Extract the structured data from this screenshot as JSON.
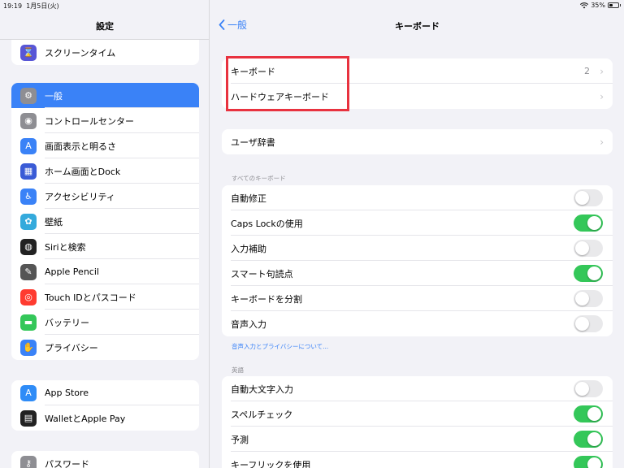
{
  "status": {
    "time": "19:19",
    "date": "1月5日(火)",
    "battery": "35%",
    "battery_level": 0.35
  },
  "sidebar": {
    "title": "設定",
    "groups": [
      [
        {
          "label": "スクリーンタイム",
          "icon": "hourglass-icon",
          "color": "#5856d6"
        }
      ],
      [
        {
          "label": "一般",
          "icon": "gear-icon",
          "color": "#8e8e93",
          "active": true
        },
        {
          "label": "コントロールセンター",
          "icon": "switches-icon",
          "color": "#8e8e93"
        },
        {
          "label": "画面表示と明るさ",
          "icon": "text-size-icon",
          "color": "#3a82f7"
        },
        {
          "label": "ホーム画面とDock",
          "icon": "grid-icon",
          "color": "#3a5bd6"
        },
        {
          "label": "アクセシビリティ",
          "icon": "accessibility-icon",
          "color": "#3a82f7"
        },
        {
          "label": "壁紙",
          "icon": "flower-icon",
          "color": "#34aadc"
        },
        {
          "label": "Siriと検索",
          "icon": "siri-icon",
          "color": "#222222"
        },
        {
          "label": "Apple Pencil",
          "icon": "pencil-icon",
          "color": "#555555"
        },
        {
          "label": "Touch IDとパスコード",
          "icon": "fingerprint-icon",
          "color": "#ff3b30"
        },
        {
          "label": "バッテリー",
          "icon": "battery-icon",
          "color": "#34c759"
        },
        {
          "label": "プライバシー",
          "icon": "hand-icon",
          "color": "#3a82f7"
        }
      ],
      [
        {
          "label": "App Store",
          "icon": "appstore-icon",
          "color": "#2f8cf7"
        },
        {
          "label": "WalletとApple Pay",
          "icon": "wallet-icon",
          "color": "#222222"
        }
      ],
      [
        {
          "label": "パスワード",
          "icon": "key-icon",
          "color": "#8e8e93"
        }
      ]
    ]
  },
  "main": {
    "back_label": "一般",
    "title": "キーボード",
    "group1": [
      {
        "label": "キーボード",
        "value": "2"
      },
      {
        "label": "ハードウェアキーボード",
        "value": ""
      }
    ],
    "group2": [
      {
        "label": "ユーザ辞書",
        "value": ""
      }
    ],
    "section_all": "すべてのキーボード",
    "all_keyboards": [
      {
        "label": "自動修正",
        "on": false
      },
      {
        "label": "Caps Lockの使用",
        "on": true
      },
      {
        "label": "入力補助",
        "on": false
      },
      {
        "label": "スマート句読点",
        "on": true
      },
      {
        "label": "キーボードを分割",
        "on": false
      },
      {
        "label": "音声入力",
        "on": false
      }
    ],
    "privacy_link": "音声入力とプライバシーについて...",
    "section_en": "英語",
    "english": [
      {
        "label": "自動大文字入力",
        "on": false
      },
      {
        "label": "スペルチェック",
        "on": true
      },
      {
        "label": "予測",
        "on": true
      },
      {
        "label": "キーフリックを使用",
        "on": true
      }
    ]
  }
}
